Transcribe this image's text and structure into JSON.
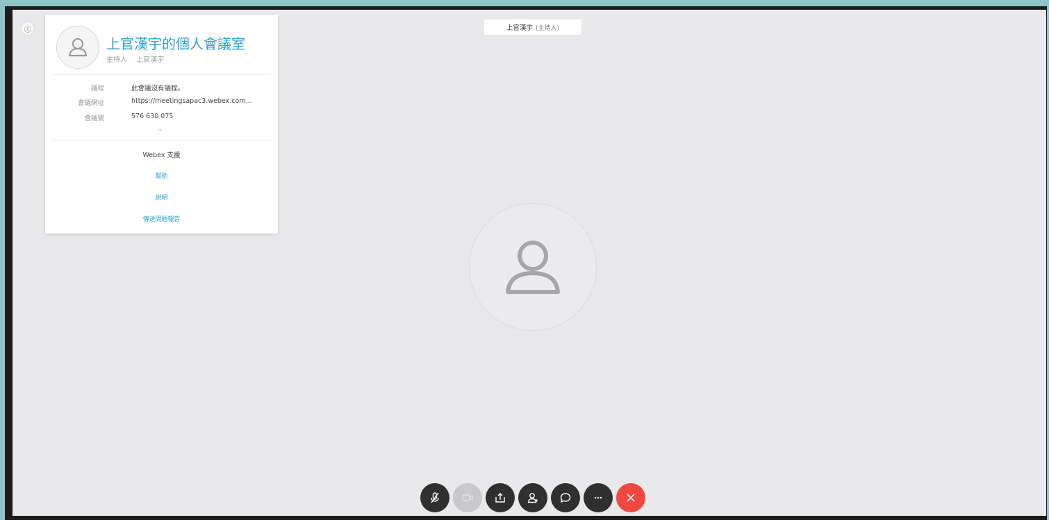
{
  "meeting": {
    "room_title": "上官漢宇的個人會議室",
    "host_label": "主持人",
    "host_name": "上官漢宇"
  },
  "details": [
    {
      "key": "議程",
      "value": "此會議沒有議程。"
    },
    {
      "key": "會議網址",
      "value": "https://meetingsapac3.webex.com..."
    },
    {
      "key": "會議號",
      "value": "576 630 075"
    }
  ],
  "support": {
    "title": "Webex 支援",
    "links": [
      "幫助",
      "說明",
      "傳送問題報告"
    ]
  },
  "participant": {
    "name": "上官漢宇",
    "role": "(主持人)"
  },
  "toolbar": {
    "buttons": [
      {
        "icon": "mic-muted-icon"
      },
      {
        "icon": "video-icon"
      },
      {
        "icon": "share-icon"
      },
      {
        "icon": "participants-icon"
      },
      {
        "icon": "chat-icon"
      },
      {
        "icon": "more-icon"
      },
      {
        "icon": "end-meeting-icon"
      }
    ]
  },
  "colors": {
    "accent": "#2b9fd6",
    "end": "#f0483e",
    "stage": "#e9e9eb"
  }
}
